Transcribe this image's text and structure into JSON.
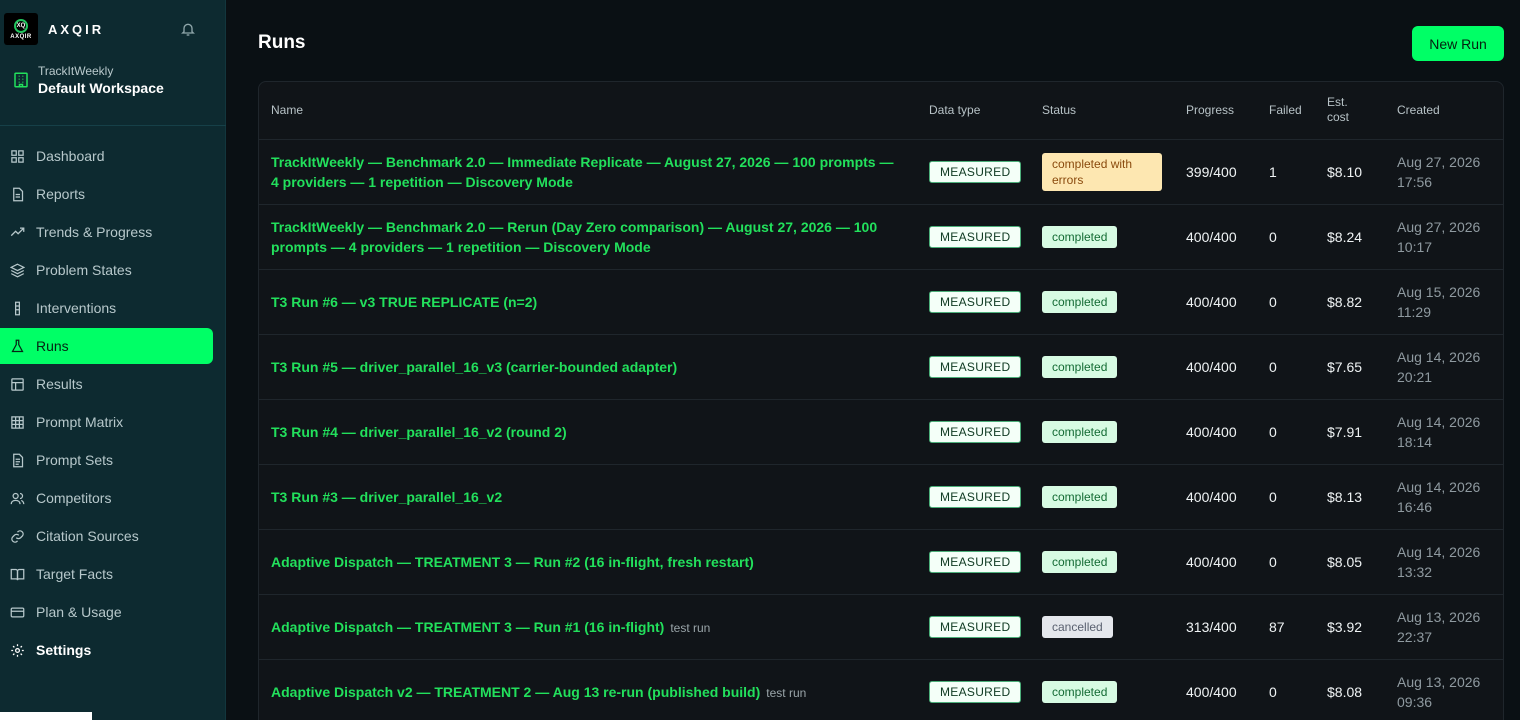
{
  "app": {
    "brand": "AXQIR",
    "logo_text": "AXQIR",
    "workspace_org": "TrackItWeekly",
    "workspace_name": "Default Workspace"
  },
  "sidebar": {
    "items": [
      {
        "label": "Dashboard",
        "icon": "dashboard-icon"
      },
      {
        "label": "Reports",
        "icon": "reports-icon"
      },
      {
        "label": "Trends & Progress",
        "icon": "trends-icon"
      },
      {
        "label": "Problem States",
        "icon": "layers-icon"
      },
      {
        "label": "Interventions",
        "icon": "intervention-icon"
      },
      {
        "label": "Runs",
        "icon": "flask-icon",
        "active": true
      },
      {
        "label": "Results",
        "icon": "results-icon"
      },
      {
        "label": "Prompt Matrix",
        "icon": "grid-icon"
      },
      {
        "label": "Prompt Sets",
        "icon": "document-icon"
      },
      {
        "label": "Competitors",
        "icon": "users-icon"
      },
      {
        "label": "Citation Sources",
        "icon": "link-icon"
      },
      {
        "label": "Target Facts",
        "icon": "book-icon"
      },
      {
        "label": "Plan & Usage",
        "icon": "card-icon"
      },
      {
        "label": "Settings",
        "icon": "gear-icon"
      }
    ]
  },
  "main": {
    "title": "Runs",
    "new_run_label": "New Run",
    "columns": [
      "Name",
      "Data type",
      "Status",
      "Progress",
      "Failed",
      "Est.\ncost",
      "Created"
    ],
    "rows": [
      {
        "name": "TrackItWeekly — Benchmark 2.0 — Immediate Replicate — August 27, 2026 — 100 prompts — 4 providers — 1 repetition — Discovery Mode",
        "tag": "",
        "data_type": "MEASURED",
        "status": "completed with errors",
        "status_kind": "errors",
        "progress": "399/400",
        "failed": "1",
        "cost": "$8.10",
        "created_date": "Aug 27, 2026",
        "created_time": "17:56"
      },
      {
        "name": "TrackItWeekly — Benchmark 2.0 — Rerun (Day Zero comparison) — August 27, 2026 — 100 prompts — 4 providers — 1 repetition — Discovery Mode",
        "tag": "",
        "data_type": "MEASURED",
        "status": "completed",
        "status_kind": "completed",
        "progress": "400/400",
        "failed": "0",
        "cost": "$8.24",
        "created_date": "Aug 27, 2026",
        "created_time": "10:17"
      },
      {
        "name": "T3 Run #6 — v3 TRUE REPLICATE (n=2)",
        "tag": "",
        "data_type": "MEASURED",
        "status": "completed",
        "status_kind": "completed",
        "progress": "400/400",
        "failed": "0",
        "cost": "$8.82",
        "created_date": "Aug 15, 2026",
        "created_time": "11:29"
      },
      {
        "name": "T3 Run #5 — driver_parallel_16_v3 (carrier-bounded adapter)",
        "tag": "",
        "data_type": "MEASURED",
        "status": "completed",
        "status_kind": "completed",
        "progress": "400/400",
        "failed": "0",
        "cost": "$7.65",
        "created_date": "Aug 14, 2026",
        "created_time": "20:21"
      },
      {
        "name": "T3 Run #4 — driver_parallel_16_v2 (round 2)",
        "tag": "",
        "data_type": "MEASURED",
        "status": "completed",
        "status_kind": "completed",
        "progress": "400/400",
        "failed": "0",
        "cost": "$7.91",
        "created_date": "Aug 14, 2026",
        "created_time": "18:14"
      },
      {
        "name": "T3 Run #3 — driver_parallel_16_v2",
        "tag": "",
        "data_type": "MEASURED",
        "status": "completed",
        "status_kind": "completed",
        "progress": "400/400",
        "failed": "0",
        "cost": "$8.13",
        "created_date": "Aug 14, 2026",
        "created_time": "16:46"
      },
      {
        "name": "Adaptive Dispatch — TREATMENT 3 — Run #2 (16 in-flight, fresh restart)",
        "tag": "",
        "data_type": "MEASURED",
        "status": "completed",
        "status_kind": "completed",
        "progress": "400/400",
        "failed": "0",
        "cost": "$8.05",
        "created_date": "Aug 14, 2026",
        "created_time": "13:32"
      },
      {
        "name": "Adaptive Dispatch — TREATMENT 3 — Run #1 (16 in-flight)",
        "tag": "test run",
        "data_type": "MEASURED",
        "status": "cancelled",
        "status_kind": "cancelled",
        "progress": "313/400",
        "failed": "87",
        "cost": "$3.92",
        "created_date": "Aug 13, 2026",
        "created_time": "22:37"
      },
      {
        "name": "Adaptive Dispatch v2 — TREATMENT 2 — Aug 13 re-run (published build)",
        "tag": "test run",
        "data_type": "MEASURED",
        "status": "completed",
        "status_kind": "completed",
        "progress": "400/400",
        "failed": "0",
        "cost": "$8.08",
        "created_date": "Aug 13, 2026",
        "created_time": "09:36"
      }
    ]
  },
  "colors": {
    "accent": "#00ff66",
    "sidebar_bg": "#0d2a30",
    "page_bg": "#0a1014",
    "link_green": "#22e05c"
  }
}
